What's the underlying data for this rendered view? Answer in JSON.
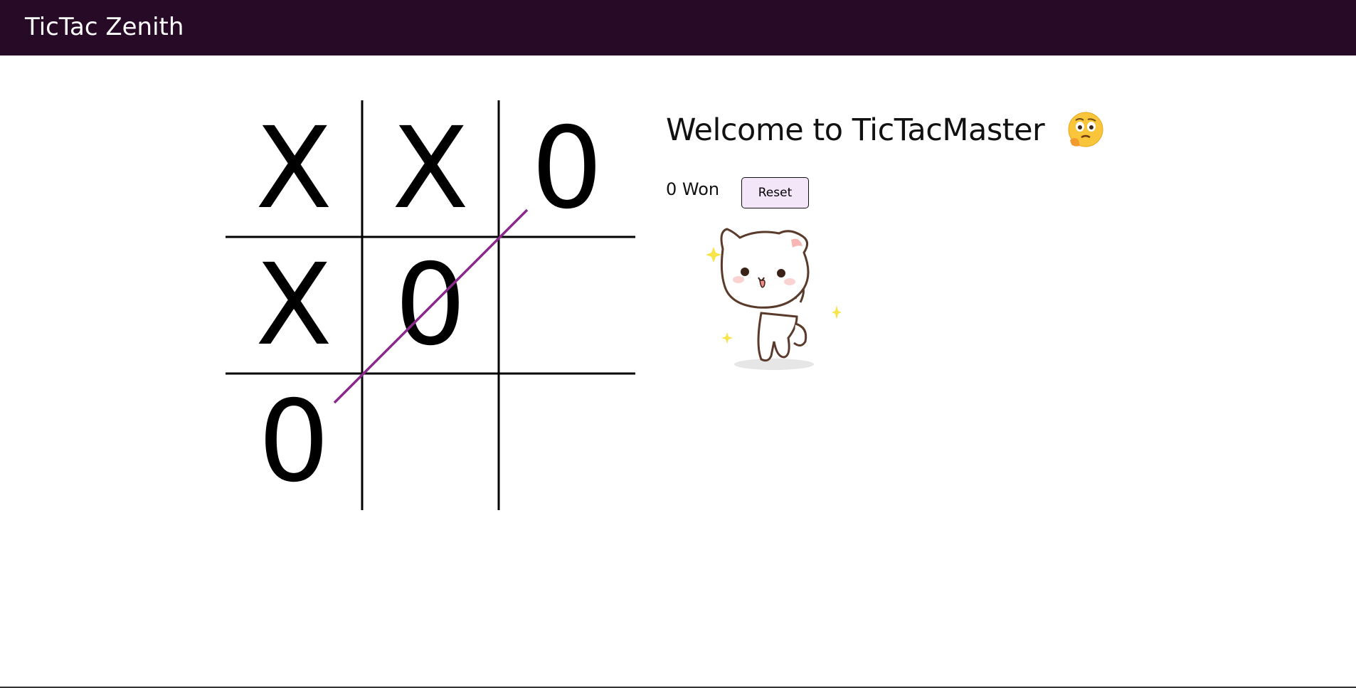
{
  "navbar": {
    "title": "TicTac Zenith",
    "background": "#260a26"
  },
  "board": {
    "cells": [
      "X",
      "X",
      "0",
      "X",
      "0",
      "",
      "0",
      "",
      ""
    ],
    "grid_color": "#000000",
    "win_line_color": "#8a2a8e"
  },
  "info": {
    "welcome": "Welcome to TicTacMaster",
    "emoji": "thinking-face-icon",
    "score_label": "0 Won",
    "reset_label": "Reset",
    "reset_bg": "#f3e6f9",
    "mascot": "dancing-cat-icon"
  }
}
